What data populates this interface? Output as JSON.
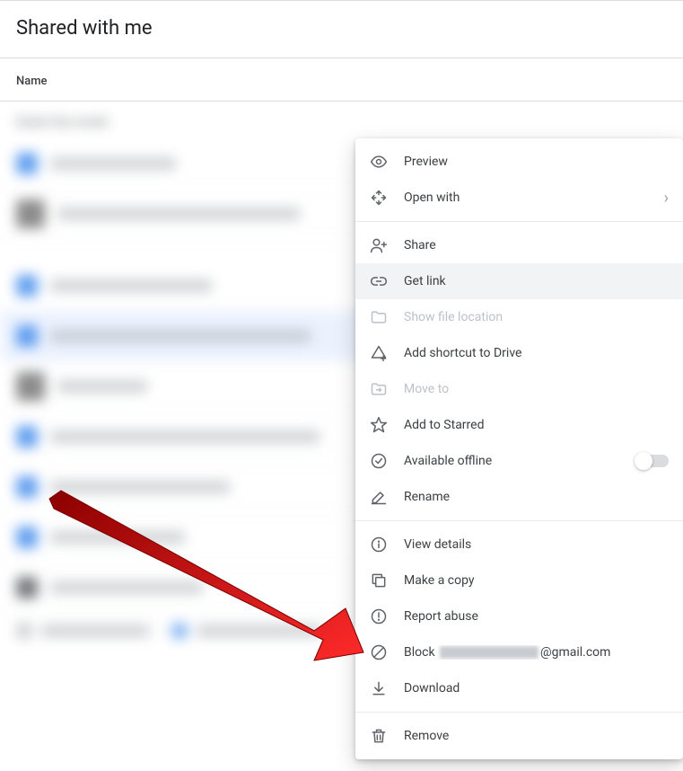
{
  "page": {
    "title": "Shared with me",
    "columns": {
      "name": "Name"
    },
    "section_label": "Earlier this month"
  },
  "menu": {
    "preview": "Preview",
    "open_with": "Open with",
    "share": "Share",
    "get_link": "Get link",
    "show_file_location": "Show file location",
    "add_shortcut": "Add shortcut to Drive",
    "move_to": "Move to",
    "add_starred": "Add to Starred",
    "available_offline": "Available offline",
    "rename": "Rename",
    "view_details": "View details",
    "make_copy": "Make a copy",
    "report_abuse": "Report abuse",
    "block_prefix": "Block ",
    "block_suffix": "@gmail.com",
    "download": "Download",
    "remove": "Remove"
  }
}
